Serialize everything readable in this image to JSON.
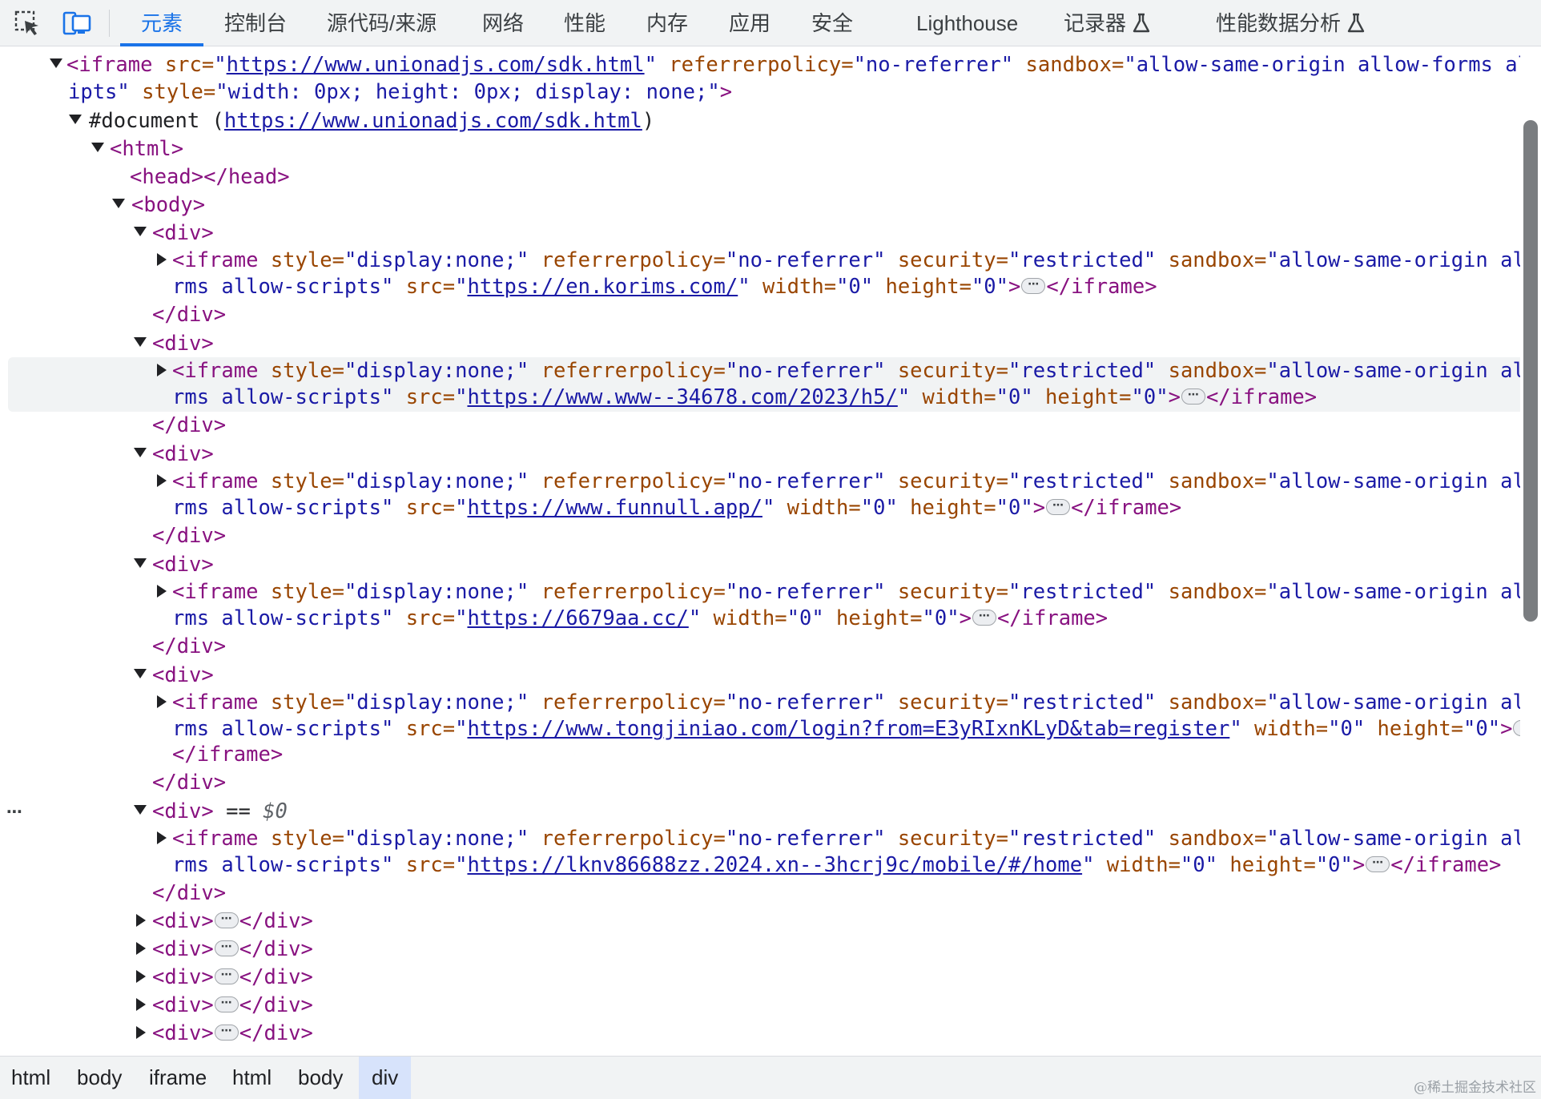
{
  "toolbar": {
    "inspect_icon": "inspect-element-icon",
    "device_icon": "device-toolbar-icon"
  },
  "tabs": [
    {
      "label": "元素",
      "active": true
    },
    {
      "label": "控制台"
    },
    {
      "label": "源代码/来源"
    },
    {
      "label": "网络"
    },
    {
      "label": "性能"
    },
    {
      "label": "内存"
    },
    {
      "label": "应用"
    },
    {
      "label": "安全"
    },
    {
      "label": "Lighthouse"
    },
    {
      "label": "记录器",
      "icon": "flask-icon"
    },
    {
      "label": "性能数据分析",
      "icon": "flask-icon"
    }
  ],
  "tree": {
    "r0": {
      "open": "<iframe",
      "a1n": " src=",
      "a1v_q1": "\"",
      "a1v": "https://www.unionadjs.com/sdk.html",
      "a1v_q2": "\"",
      "a2n": " referrerpolicy=",
      "a2v": "\"no-referrer\"",
      "a3n": " sandbox=",
      "a3v": "\"allow-same-origin allow-forms allow-sc"
    },
    "r0b": {
      "a3v": "ipts\"",
      "a4n": " style=",
      "a4v": "\"width: 0px; height: 0px; display: none;\"",
      "close": ">"
    },
    "r1": {
      "text": "#document (",
      "url": "https://www.unionadjs.com/sdk.html",
      "end": ")"
    },
    "r2": "<html>",
    "r3": "<head></head>",
    "r4": "<body>",
    "div_open": "<div>",
    "div_close": "</div>",
    "iframe_close": "</iframe>",
    "iframe_head": {
      "open": "<iframe",
      "style_n": " style=",
      "style_v": "\"display:none;\"",
      "ref_n": " referrerpolicy=",
      "ref_v": "\"no-referrer\"",
      "sec_n": " security=",
      "sec_v": "\"restricted\"",
      "sb_n": " sandbox=",
      "sb_v": "\"allow-same-origin allow-fo"
    },
    "iframe_cont": {
      "sb_v": "rms allow-scripts\"",
      "src_n": " src=",
      "q": "\"",
      "w_n": " width=",
      "w_v": "\"0\"",
      "h_n": " height=",
      "h_v": "\"0\"",
      "gt": ">"
    },
    "srcs": [
      "https://en.korims.com/",
      "https://www.www--34678.com/2023/h5/",
      "https://www.funnull.app/",
      "https://6679aa.cc/",
      "https://www.tongjiniao.com/login?from=E3yRIxnKLyD&tab=register",
      "https://lknv86688zz.2024.xn--3hcrj9c/mobile/#/home"
    ],
    "selected_suffix": " == ",
    "selected_var": "$0",
    "ellipsis": "⋯",
    "row_dots": "⋯"
  },
  "breadcrumbs": [
    "html",
    "body",
    "iframe",
    "html",
    "body",
    "div"
  ],
  "watermark": "@稀土掘金技术社区"
}
